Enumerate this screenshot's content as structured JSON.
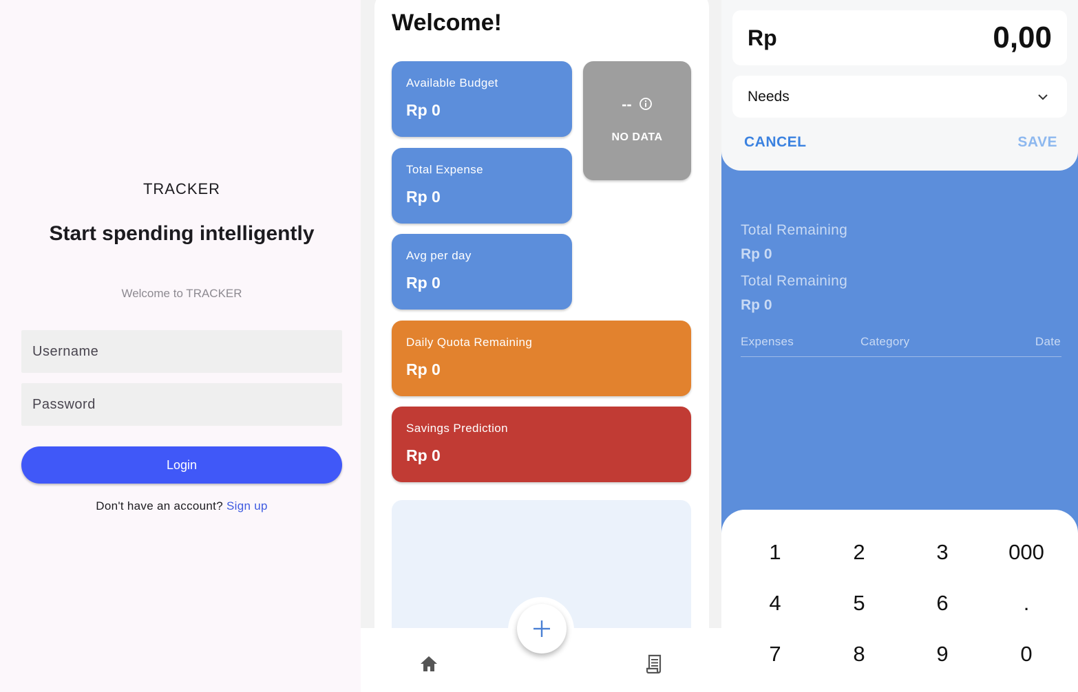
{
  "login": {
    "app_name": "TRACKER",
    "headline": "Start spending intelligently",
    "subtitle": "Welcome to TRACKER",
    "username_placeholder": "Username",
    "password_placeholder": "Password",
    "login_label": "Login",
    "no_account_text": "Don't have an account?",
    "signup_label": "Sign up"
  },
  "dashboard": {
    "title": "Welcome!",
    "cards": [
      {
        "label": "Available Budget",
        "value": "Rp 0",
        "color": "#5c8edb"
      },
      {
        "label": "Total Expense",
        "value": "Rp 0",
        "color": "#5c8edb"
      },
      {
        "label": "Avg per day",
        "value": "Rp 0",
        "color": "#5c8edb"
      },
      {
        "label": "Daily Quota Remaining",
        "value": "Rp 0",
        "color": "#e2822e"
      },
      {
        "label": "Savings Prediction",
        "value": "Rp 0",
        "color": "#c13b34"
      }
    ],
    "no_data": {
      "glyph": "--",
      "label": "NO DATA",
      "icon": "info-icon"
    },
    "fab_icon": "plus-icon",
    "nav": {
      "home_icon": "home-icon",
      "records_icon": "receipt-icon"
    }
  },
  "add_expense": {
    "currency": "Rp",
    "amount": "0,00",
    "category": "Needs",
    "category_icon": "chevron-down-icon",
    "cancel_label": "CANCEL",
    "save_label": "SAVE",
    "summary": [
      {
        "label": "Total Remaining",
        "value": "Rp 0"
      },
      {
        "label": "Total Remaining",
        "value": "Rp 0"
      }
    ],
    "columns": [
      "Expenses",
      "Category",
      "Date"
    ],
    "keys": [
      "1",
      "2",
      "3",
      "000",
      "4",
      "5",
      "6",
      ".",
      "7",
      "8",
      "9",
      "0"
    ]
  },
  "colors": {
    "primary_button": "#4058f8",
    "link": "#3d5ae0",
    "accent_blue": "#5c8edb",
    "cancel": "#3b82e0",
    "save_disabled": "#8db8ef"
  }
}
